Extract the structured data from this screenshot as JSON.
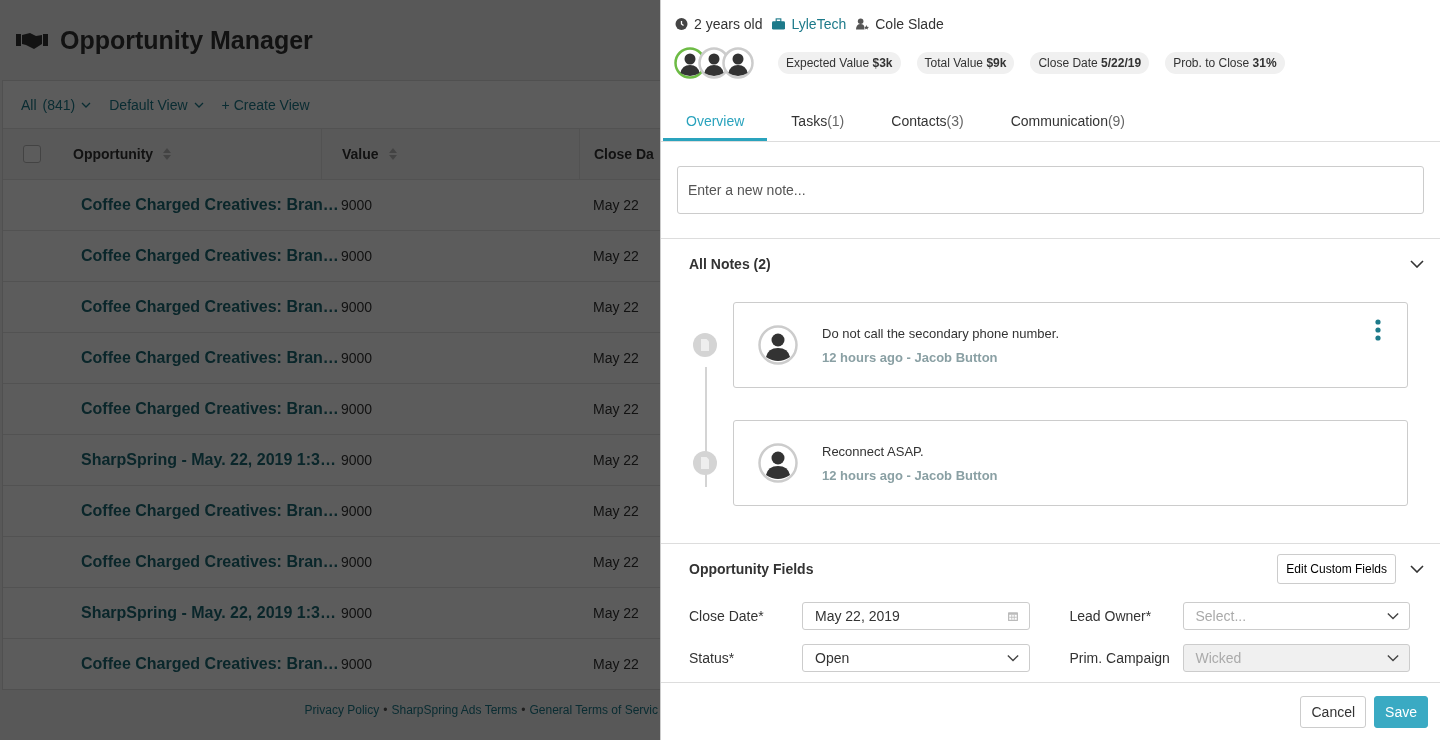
{
  "page": {
    "title": "Opportunity Manager",
    "toolbar": [
      {
        "label": "All",
        "count": "(841)",
        "kind": "dropdown"
      },
      {
        "label": "Default View",
        "kind": "dropdown"
      },
      {
        "label": "+ Create View",
        "kind": "link"
      }
    ],
    "table": {
      "select_all_checked": false,
      "columns": [
        "Opportunity",
        "Value",
        "Close Da"
      ],
      "rows": [
        {
          "opportunity": "Coffee Charged Creatives: Bran…",
          "value": "9000",
          "close_date": "May 22"
        },
        {
          "opportunity": "Coffee Charged Creatives: Bran…",
          "value": "9000",
          "close_date": "May 22"
        },
        {
          "opportunity": "Coffee Charged Creatives: Bran…",
          "value": "9000",
          "close_date": "May 22"
        },
        {
          "opportunity": "Coffee Charged Creatives: Bran…",
          "value": "9000",
          "close_date": "May 22"
        },
        {
          "opportunity": "Coffee Charged Creatives: Bran…",
          "value": "9000",
          "close_date": "May 22"
        },
        {
          "opportunity": "SharpSpring - May. 22, 2019 1:3…",
          "value": "9000",
          "close_date": "May 22"
        },
        {
          "opportunity": "Coffee Charged Creatives: Bran…",
          "value": "9000",
          "close_date": "May 22"
        },
        {
          "opportunity": "Coffee Charged Creatives: Bran…",
          "value": "9000",
          "close_date": "May 22"
        },
        {
          "opportunity": "SharpSpring - May. 22, 2019 1:3…",
          "value": "9000",
          "close_date": "May 22"
        },
        {
          "opportunity": "Coffee Charged Creatives: Bran…",
          "value": "9000",
          "close_date": "May 22"
        }
      ]
    },
    "footer_links": [
      {
        "kind": "link",
        "label": "Privacy Policy"
      },
      {
        "kind": "separator",
        "label": "•"
      },
      {
        "kind": "link",
        "label": "SharpSpring Ads Terms"
      },
      {
        "kind": "separator",
        "label": "•"
      },
      {
        "kind": "link",
        "label": "General Terms of Servic"
      }
    ]
  },
  "panel": {
    "age": "2 years old",
    "company": "LyleTech",
    "owner": "Cole Slade",
    "contacts": [
      {
        "primary": true
      },
      {
        "primary": false
      },
      {
        "primary": false
      }
    ],
    "stats": [
      {
        "label": "Expected Value",
        "value": "$3k"
      },
      {
        "label": "Total Value",
        "value": "$9k"
      },
      {
        "label": "Close Date",
        "value": "5/22/19"
      },
      {
        "label": "Prob. to Close",
        "value": "31%"
      }
    ],
    "tabs": [
      {
        "label": "Overview",
        "selected": true
      },
      {
        "label": "Tasks",
        "count": "(1)",
        "selected": false
      },
      {
        "label": "Contacts",
        "count": "(3)",
        "selected": false
      },
      {
        "label": "Communication",
        "count": "(9)",
        "selected": false
      }
    ],
    "note_input": {
      "placeholder": "Enter a new note..."
    },
    "notes_section": {
      "title": "All Notes (2)",
      "expanded": true,
      "notes": [
        {
          "text": "Do not call the secondary phone number.",
          "meta": "12 hours ago - Jacob Button",
          "menu": true
        },
        {
          "text": "Reconnect ASAP.",
          "meta": "12 hours ago - Jacob Button",
          "menu": false
        }
      ]
    },
    "fields_section": {
      "title": "Opportunity Fields",
      "edit_button": "Edit Custom Fields",
      "expanded": true,
      "fields": [
        {
          "label": "Close Date*",
          "kind": "date",
          "value": "May 22, 2019",
          "disabled": false
        },
        {
          "label": "Lead Owner*",
          "kind": "select",
          "placeholder": "Select...",
          "disabled": false
        },
        {
          "label": "Status*",
          "kind": "select",
          "value": "Open",
          "disabled": false
        },
        {
          "label": "Prim. Campaign",
          "kind": "select",
          "value": "Wicked",
          "disabled": true
        }
      ]
    },
    "buttons": [
      {
        "label": "Cancel",
        "kind": "secondary"
      },
      {
        "label": "Save",
        "kind": "primary"
      }
    ]
  }
}
